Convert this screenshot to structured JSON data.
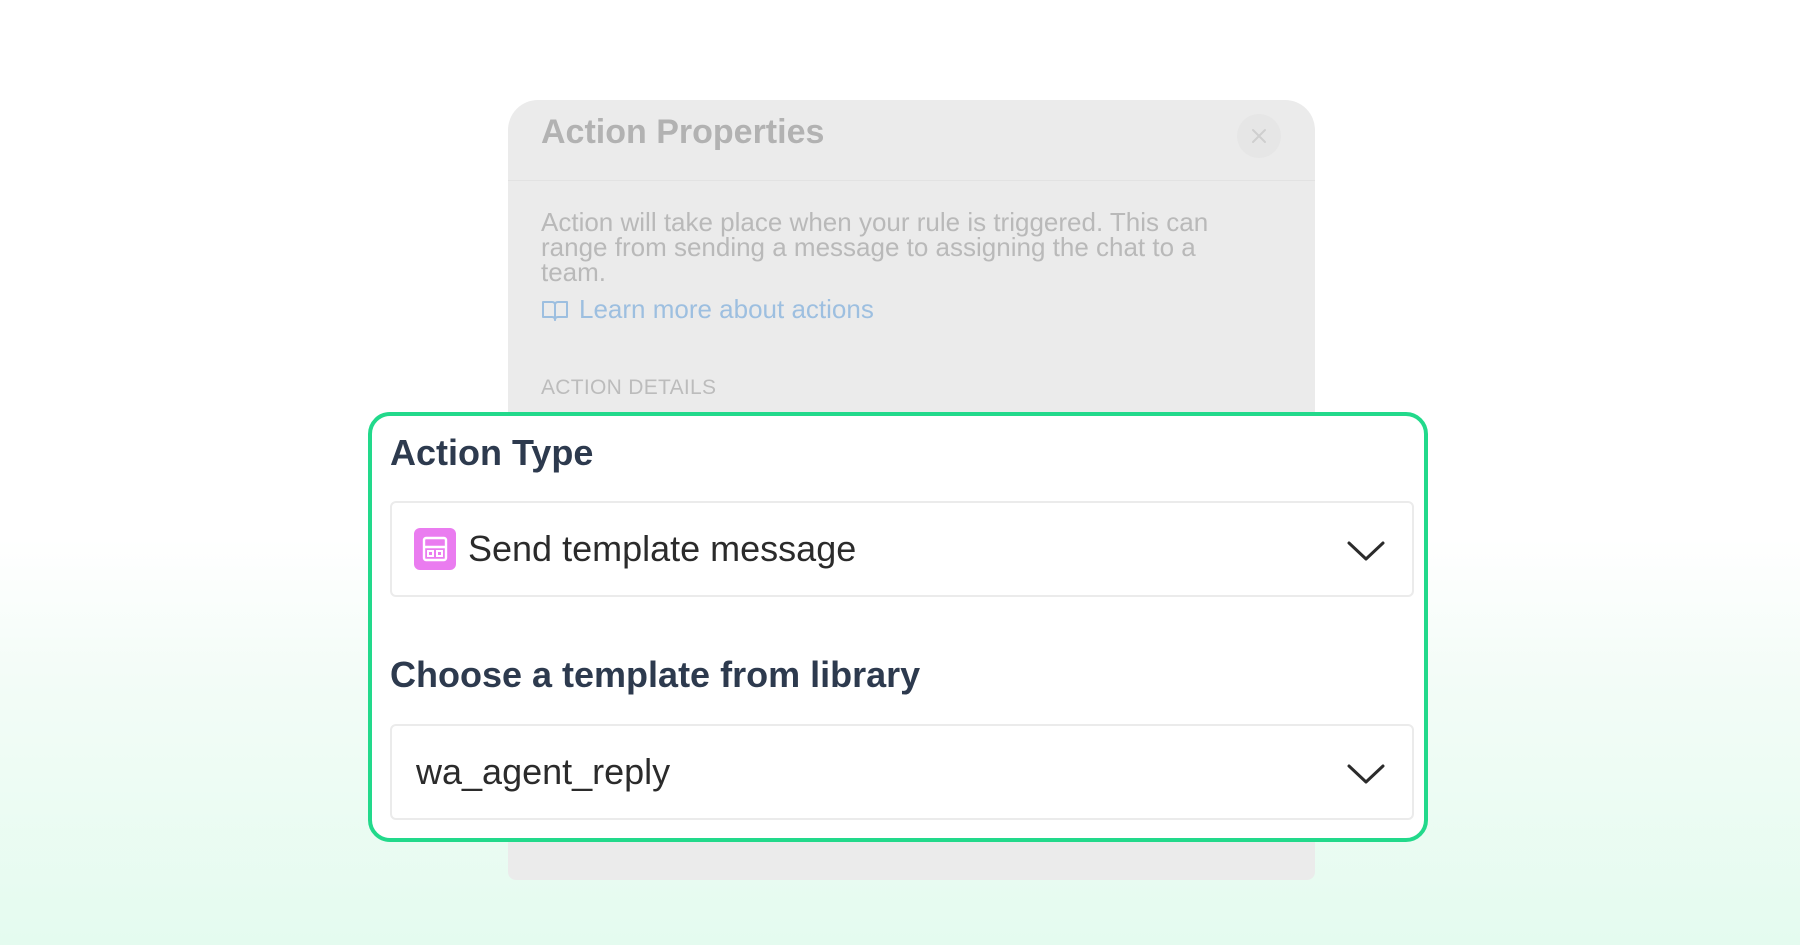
{
  "panel": {
    "title": "Action Properties",
    "description": "Action will take place when your rule is triggered. This can range from sending a message to assigning the chat to a team.",
    "learn_more_link": "Learn more about actions",
    "section_label": "ACTION DETAILS",
    "close_icon": "close-icon",
    "book_icon": "book-icon"
  },
  "action_type": {
    "label": "Action Type",
    "selected_value": "Send template message",
    "icon": "template-icon",
    "icon_color": "#ea7cf0"
  },
  "template": {
    "label": "Choose a template from library",
    "selected_value": "wa_agent_reply"
  },
  "colors": {
    "highlight_border": "#22d98b",
    "label_text": "#2d3a4e"
  }
}
